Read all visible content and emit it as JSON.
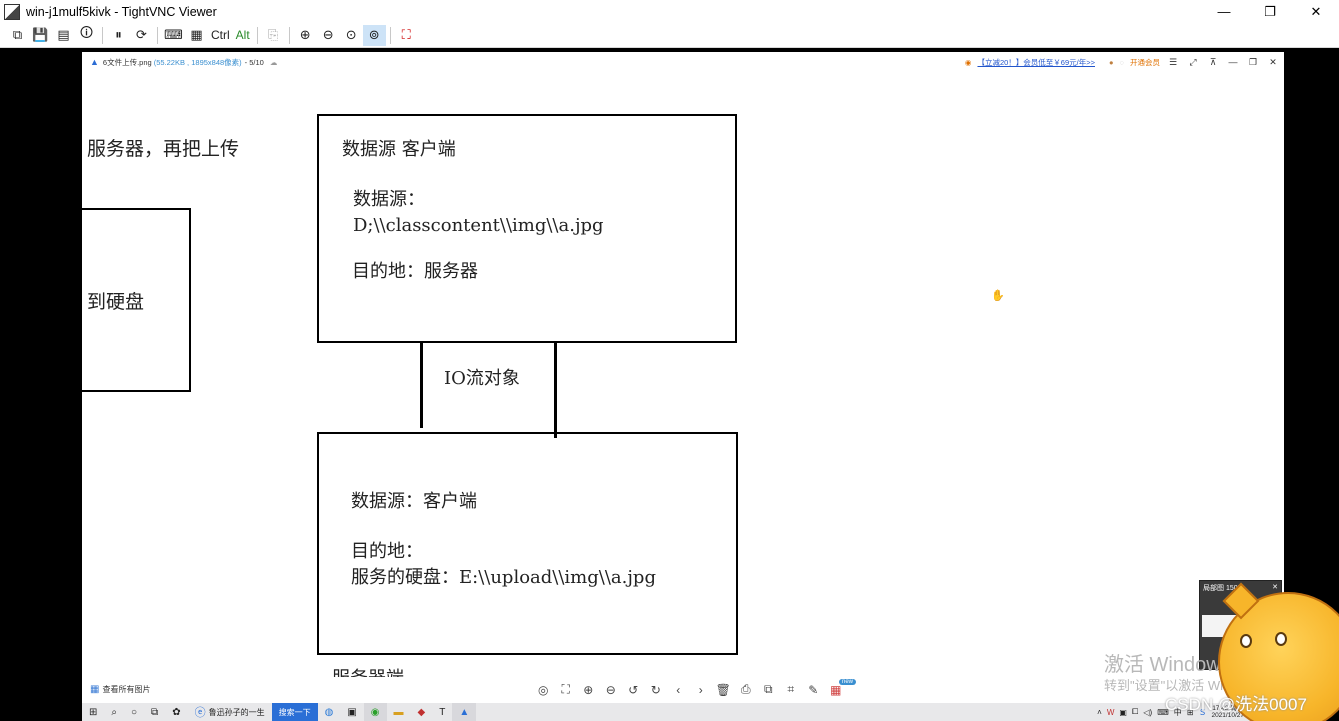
{
  "vnc": {
    "title": "win-j1mulf5kivk - TightVNC Viewer",
    "window_controls": [
      "—",
      "❐",
      "✕"
    ],
    "toolbar_ctrl": "Ctrl",
    "toolbar_alt": "Alt"
  },
  "viewer": {
    "filename": "6文件上传.png",
    "meta": "(55.22KB , 1895x848像素)",
    "page": "- 5/10",
    "promo": "【立减20！】会员低至￥69元/年>>",
    "vip": "开通会员",
    "view_all": "查看所有图片"
  },
  "canvas": {
    "cut_top": "服务器，再把上传",
    "cut_mid": "到硬盘",
    "box1": {
      "title": "数据源 客户端",
      "src_label": "数据源：",
      "src_path": "D;\\\\classcontent\\\\img\\\\a.jpg",
      "dest": "目的地：服务器"
    },
    "io_label": "IO流对象",
    "box2": {
      "src": "数据源：客户端",
      "dest_label": "目的地：",
      "dest_path": "服务的硬盘：E:\\\\upload\\\\img\\\\a.jpg"
    },
    "cut_bottom": "服务器端"
  },
  "taskbar": {
    "ie_item": "鲁迅孙子的一生",
    "search": "搜索一下",
    "clock_time": "17:42 周三",
    "clock_date": "2021/10/27",
    "ime": "中"
  },
  "overlays": {
    "magnifier_title": "局部图 150%",
    "watermark_line1": "激活 Windows",
    "watermark_line2": "转到\"设置\"以激活 Windows。",
    "csdn": "CSDN @洗法0007",
    "badge_new": "new"
  },
  "colors": {
    "accent_blue": "#2a6fd6",
    "vip_orange": "#e07000",
    "mascot_yellow": "#f7b52a"
  }
}
